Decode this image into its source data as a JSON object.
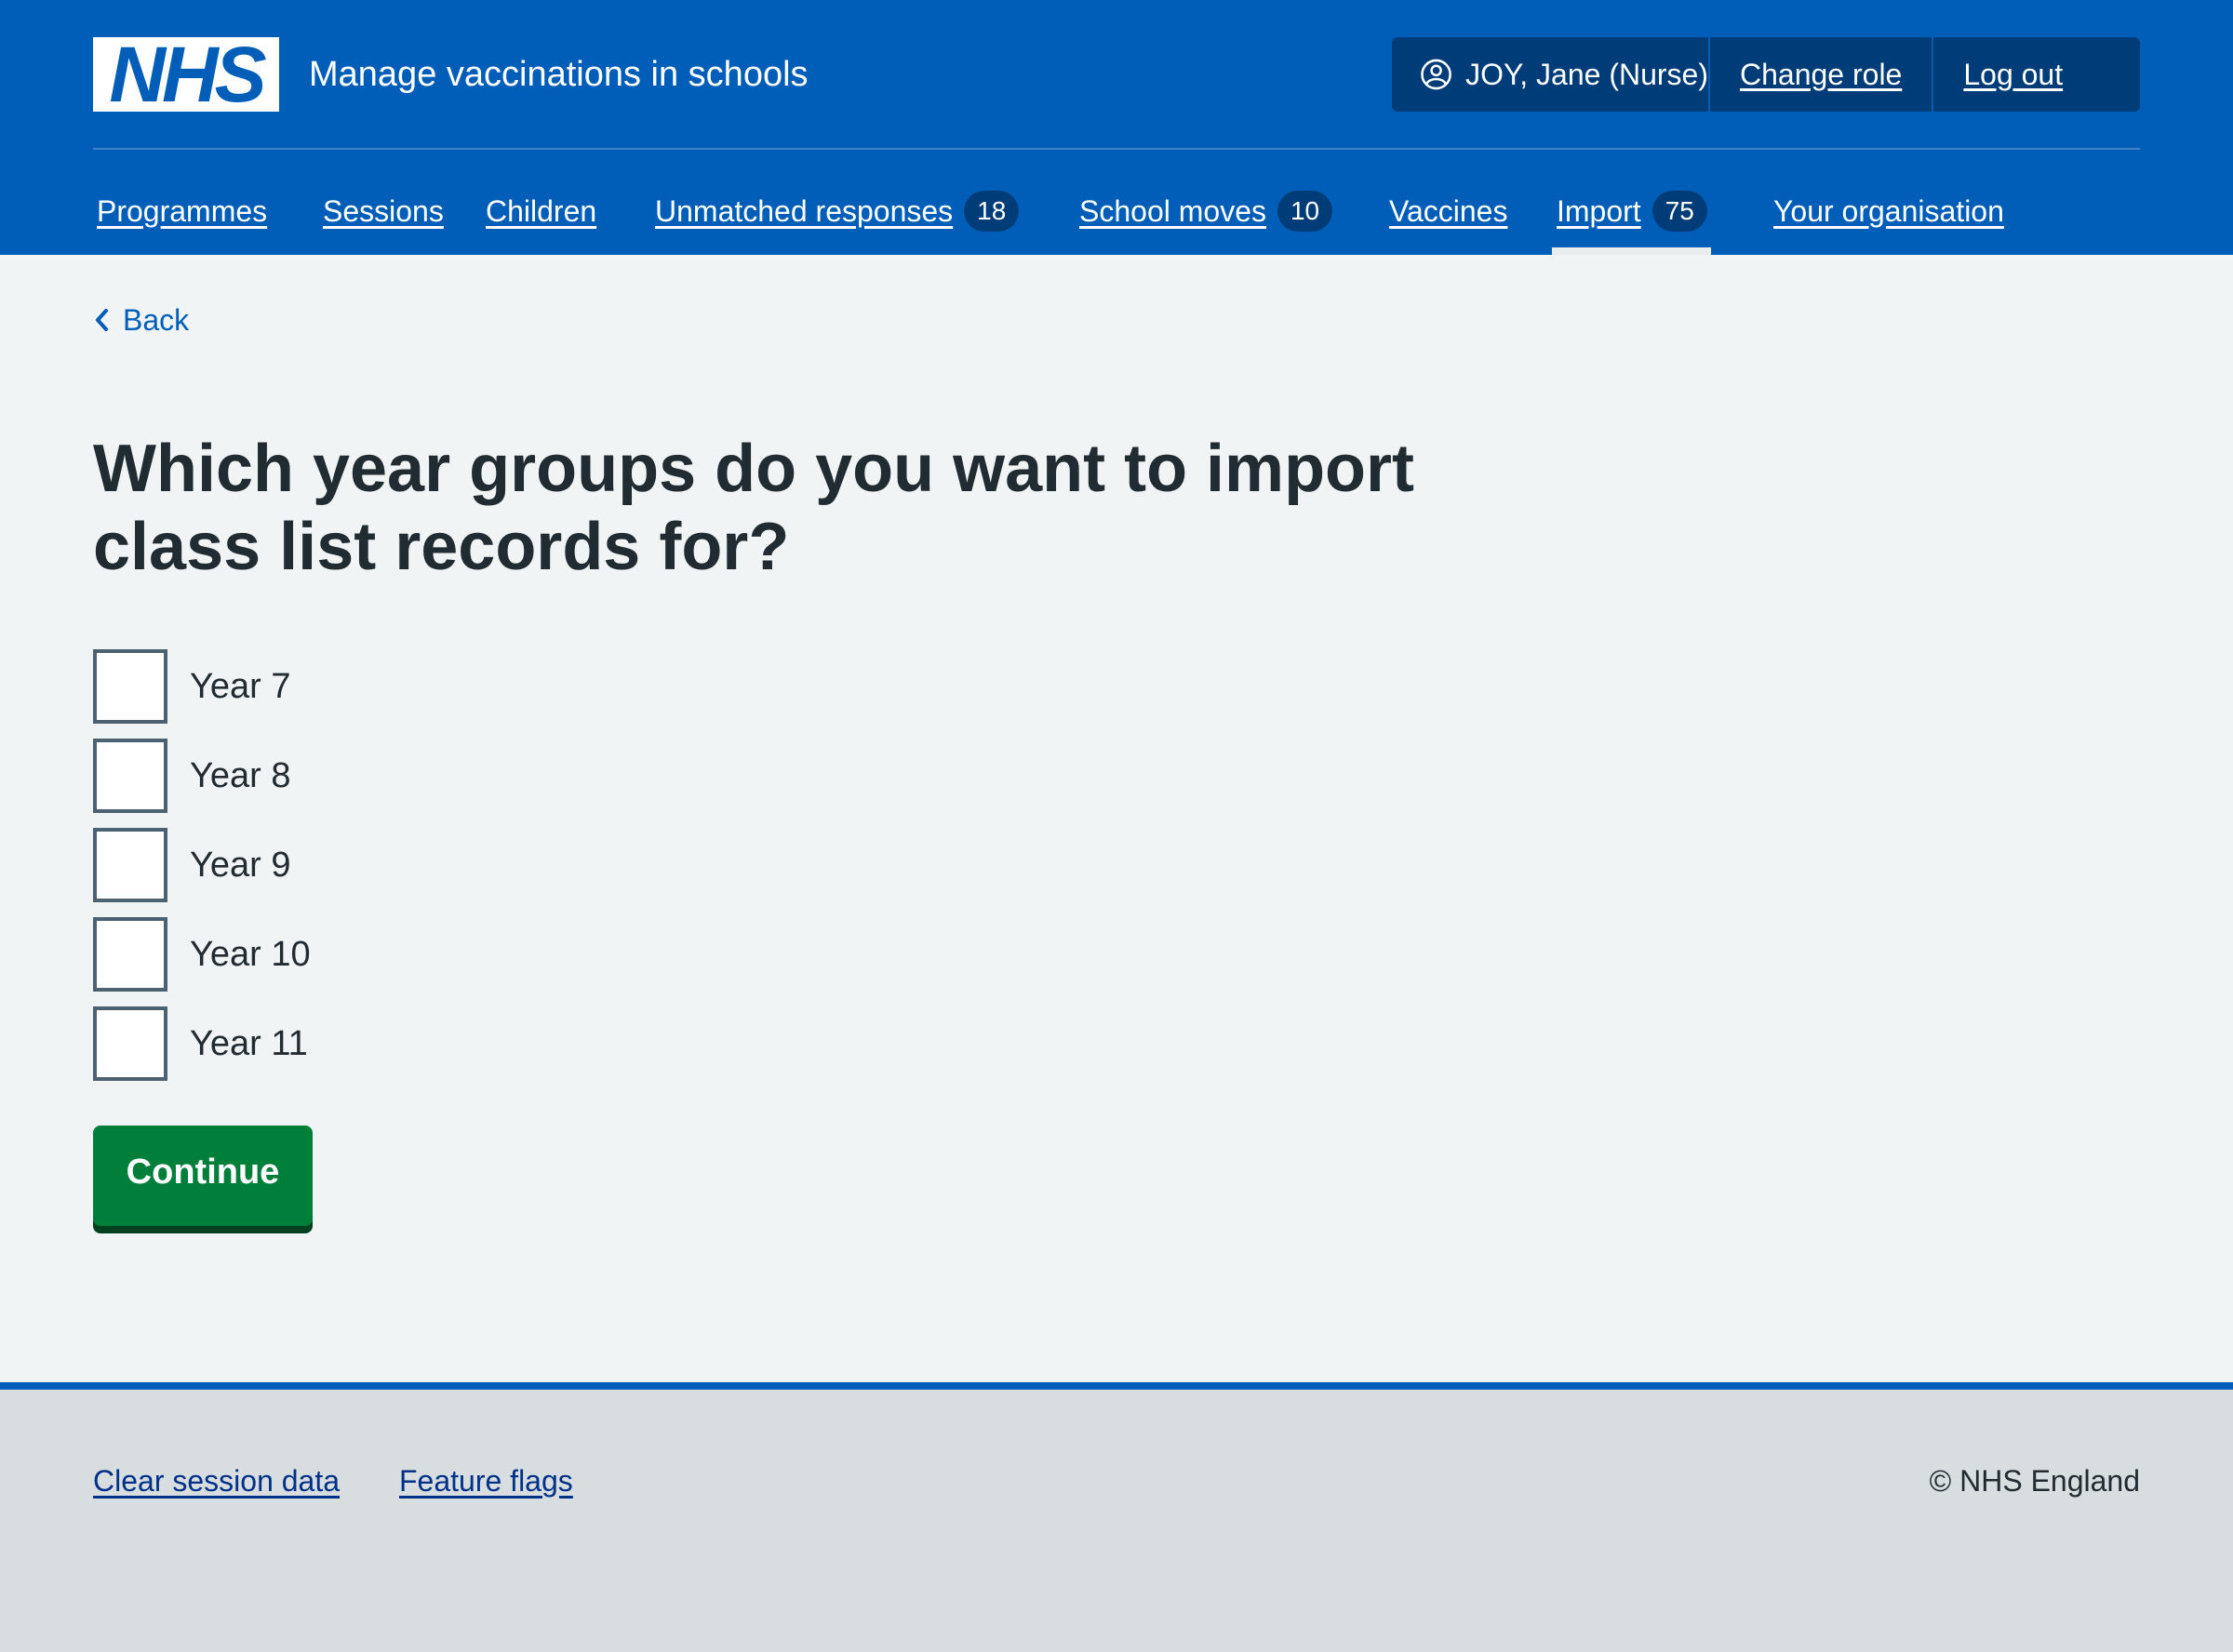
{
  "header": {
    "logo_text": "NHS",
    "service_name": "Manage vaccinations in schools",
    "account": {
      "user_label": "JOY, Jane (Nurse)",
      "change_role": "Change role",
      "log_out": "Log out"
    },
    "nav": [
      {
        "label": "Programmes"
      },
      {
        "label": "Sessions"
      },
      {
        "label": "Children"
      },
      {
        "label": "Unmatched responses",
        "count": "18"
      },
      {
        "label": "School moves",
        "count": "10"
      },
      {
        "label": "Vaccines"
      },
      {
        "label": "Import",
        "count": "75",
        "active": true
      },
      {
        "label": "Your organisation"
      }
    ]
  },
  "main": {
    "back_label": "Back",
    "title": "Which year groups do you want to import class list records for?",
    "options": [
      {
        "label": "Year 7",
        "checked": false
      },
      {
        "label": "Year 8",
        "checked": false
      },
      {
        "label": "Year 9",
        "checked": false
      },
      {
        "label": "Year 10",
        "checked": false
      },
      {
        "label": "Year 11",
        "checked": false
      }
    ],
    "continue_label": "Continue"
  },
  "footer": {
    "links": [
      "Clear session data",
      "Feature flags"
    ],
    "copyright": "© NHS England"
  },
  "colors": {
    "nhs_blue": "#005eb8",
    "dark_blue": "#003d78",
    "green": "#007f3b",
    "background": "#f0f4f5",
    "footer_bg": "#d8dde0"
  }
}
